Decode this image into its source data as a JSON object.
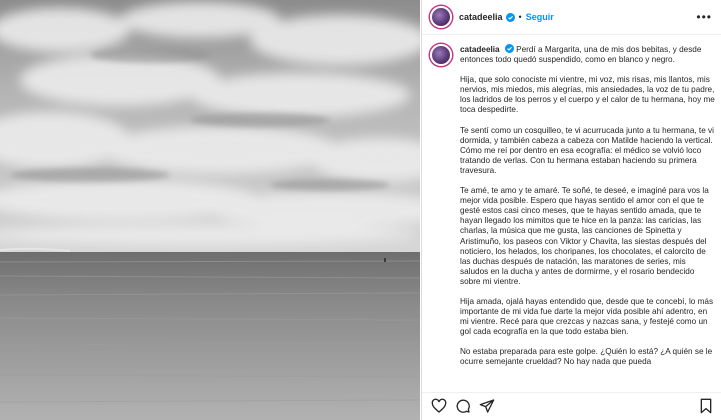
{
  "post": {
    "username": "catadeelia",
    "verified": true,
    "separator": "•",
    "follow_label": "Seguir",
    "more_label": "•••"
  },
  "image": {
    "alt_subject": "black and white seascape with cloudy sky"
  },
  "caption": {
    "p1_rest": "Perdí a Margarita, una de mis dos bebitas, y desde entonces todo quedó suspendido, como en blanco y negro.",
    "p2": "Hija, que solo conociste mi vientre, mi voz, mis risas, mis llantos, mis nervios, mis miedos, mis alegrías, mis ansiedades, la voz de tu padre, los ladridos de los perros y el cuerpo y el calor de tu hermana, hoy me toca despedirte.",
    "p3": "Te sentí como un cosquilleo, te vi acurrucada junto a tu hermana, te vi dormida, y también cabeza a cabeza con Matilde haciendo la vertical. Cómo me reí por dentro en esa ecografía: el médico se volvió loco tratando de verlas. Con tu hermana estaban haciendo su primera travesura.",
    "p4": "Te amé, te amo y te amaré. Te soñé, te deseé, e imaginé para vos la mejor vida posible. Espero que hayas sentido el amor con el que te gesté estos casi cinco meses, que te hayas sentido amada, que te hayan llegado los mimitos que te hice en la panza: las caricias, las charlas, la música que me gusta, las canciones de Spinetta y Aristimuño, los paseos con Viktor y Chavita, las siestas después del noticiero, los helados, los choripanes, los chocolates, el calorcito de las duchas después de natación, las maratones de series, mis saludos en la ducha y antes de dormirme, y el rosario bendecido sobre mi vientre.",
    "p5": "Hija amada, ojalá hayas entendido que, desde que te concebí, lo más importante de mi vida fue darte la mejor vida posible ahí adentro, en mi vientre. Recé para que crezcas y nazcas sana, y festejé como un gol cada ecografía en la que todo estaba bien.",
    "p6": "No estaba preparada para este golpe. ¿Quién lo está? ¿A quién se le ocurre semejante crueldad? No hay nada que pueda"
  },
  "actions": {
    "like_icon": "heart-icon",
    "comment_icon": "comment-icon",
    "share_icon": "share-icon",
    "save_icon": "bookmark-icon"
  }
}
